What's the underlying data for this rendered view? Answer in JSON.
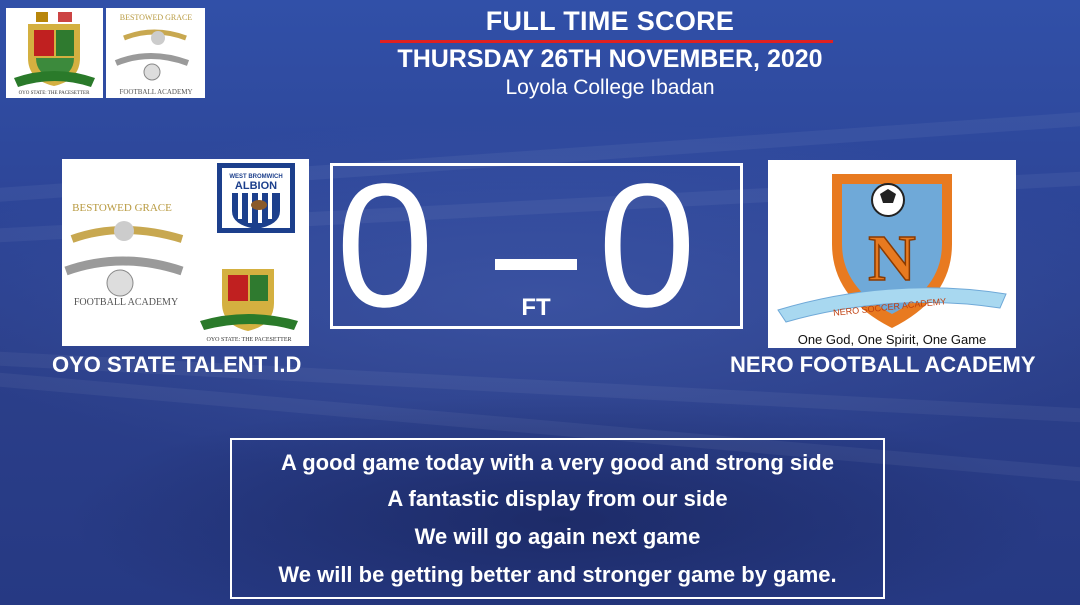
{
  "header": {
    "title": "FULL TIME SCORE",
    "date": "THURSDAY 26TH NOVEMBER, 2020",
    "venue": "Loyola College Ibadan"
  },
  "logos": {
    "oyo_state_motto": "OYO STATE: THE PACESETTER",
    "bestowed_grace_name": "BESTOWED GRACE",
    "bestowed_grace_sub": "FOOTBALL ACADEMY",
    "albion_top": "WEST BROMWICH",
    "albion_name": "ALBION",
    "nero_banner": "NERO SOCCER ACADEMY",
    "nero_motto": "One God, One Spirit, One Game"
  },
  "match": {
    "home_team": "OYO STATE TALENT I.D",
    "away_team": "NERO FOOTBALL ACADEMY",
    "home_score": "0",
    "away_score": "0",
    "status": "FT"
  },
  "message": {
    "lines": [
      "A good game today with a very good and strong side",
      "A fantastic display from our side",
      "We will go again next game",
      "We will be getting better and stronger game by game."
    ]
  },
  "colors": {
    "background": "#2d4597",
    "accent_rule": "#e02020",
    "text": "#ffffff"
  }
}
